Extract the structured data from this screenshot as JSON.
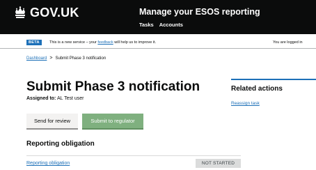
{
  "header": {
    "brand": "GOV.UK",
    "service_name": "Manage your ESOS reporting",
    "nav": [
      "Tasks",
      "Accounts"
    ]
  },
  "banner": {
    "tag": "BETA",
    "text_before": "This is a new service – your",
    "feedback_link": "feedback",
    "text_after": "will help us to improve it.",
    "logged_in": "You are logged in"
  },
  "breadcrumb": {
    "items": [
      "Dashboard",
      "Submit Phase 3 notification"
    ],
    "separator": ">"
  },
  "main": {
    "title": "Submit Phase 3 notification",
    "assigned_label": "Assigned to:",
    "assigned_value": "AL Test user",
    "buttons": {
      "send_for_review": "Send for review",
      "submit_to_regulator": "Submit to regulator"
    },
    "section_heading": "Reporting obligation",
    "tasks": [
      {
        "label": "Reporting obligation",
        "status": "NOT STARTED"
      }
    ]
  },
  "sidebar": {
    "heading": "Related actions",
    "links": [
      "Reassign task"
    ]
  },
  "colors": {
    "header_bg": "#0b0c0c",
    "link": "#1d70b8",
    "primary_button": "#7fb07f",
    "tag_grey": "#dbdcdc"
  },
  "icons": {
    "brand_logo": "crown-icon"
  }
}
